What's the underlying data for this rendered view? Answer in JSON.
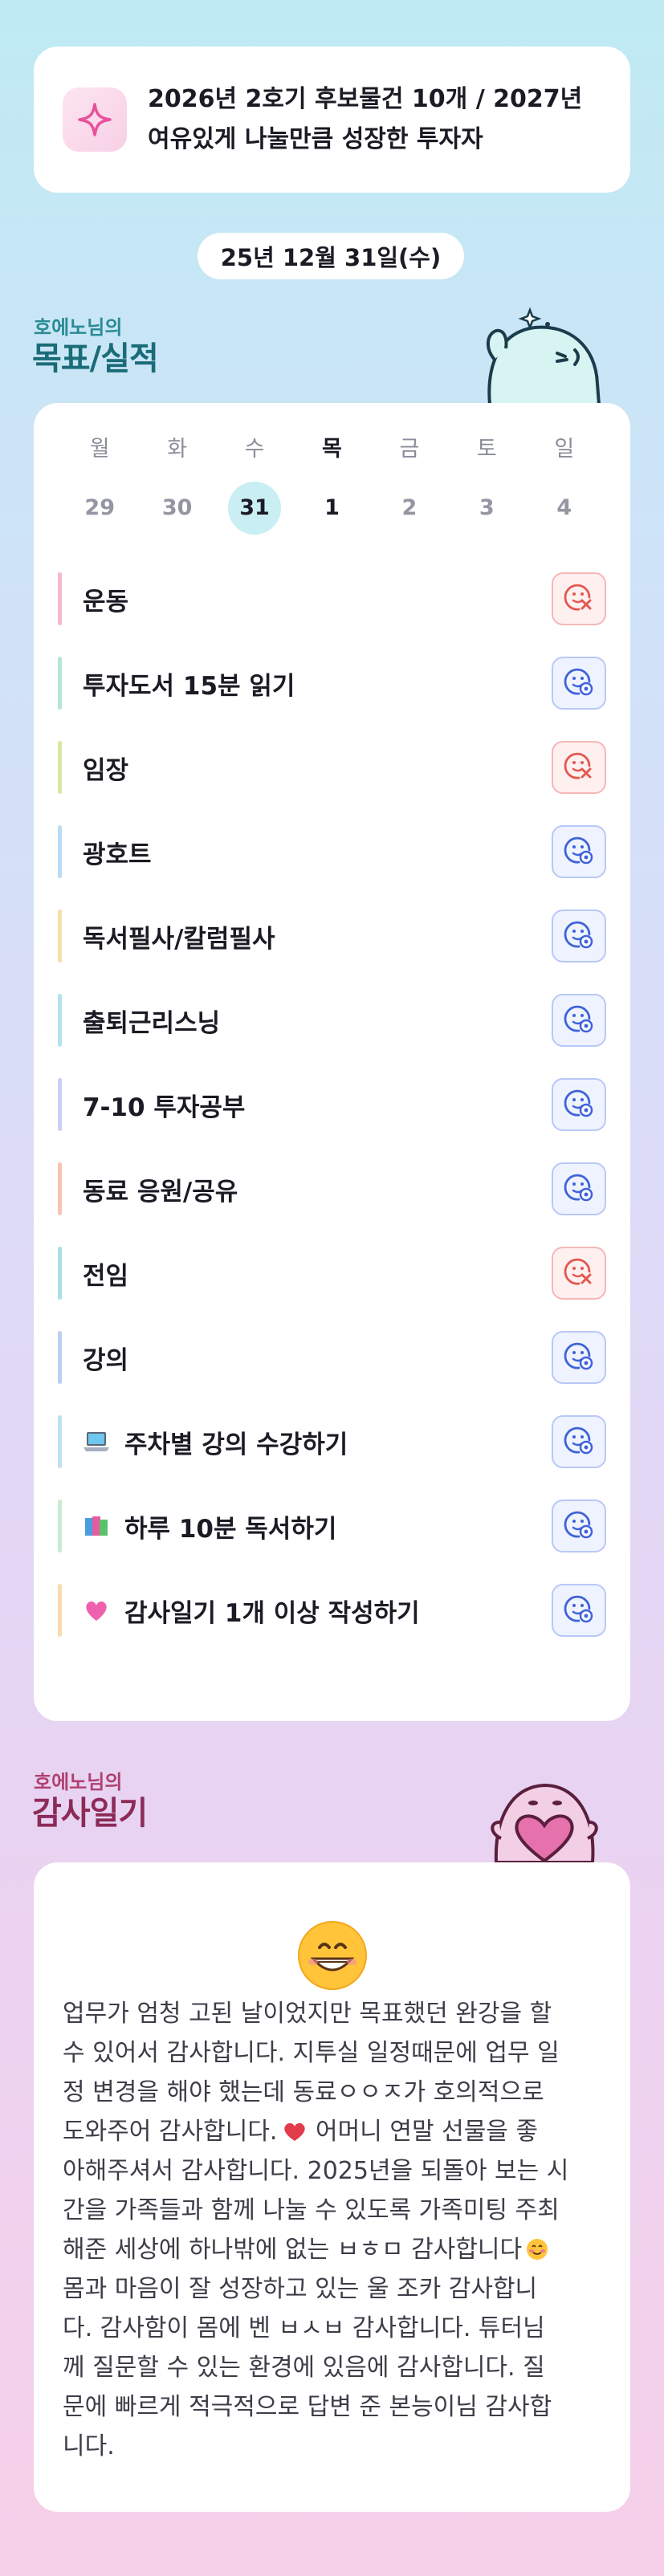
{
  "goal_banner": {
    "text": "2026년 2호기 후보물건 10개 / 2027년 여유있게 나눌만큼 성장한 투자자",
    "icon": "sparkle-icon"
  },
  "date": "25년 12월 31일(수)",
  "goals_section": {
    "subtitle": "호에노님의",
    "title": "목표/실적"
  },
  "week": [
    {
      "day": "월",
      "num": "29",
      "state": "normal"
    },
    {
      "day": "화",
      "num": "30",
      "state": "normal"
    },
    {
      "day": "수",
      "num": "31",
      "state": "today"
    },
    {
      "day": "목",
      "num": "1",
      "state": "emph"
    },
    {
      "day": "금",
      "num": "2",
      "state": "normal"
    },
    {
      "day": "토",
      "num": "3",
      "state": "normal"
    },
    {
      "day": "일",
      "num": "4",
      "state": "normal"
    }
  ],
  "goals": [
    {
      "label": "운동",
      "status": "fail",
      "bar": "#f6b9c9",
      "emoji": ""
    },
    {
      "label": "투자도서 15분 읽기",
      "status": "done",
      "bar": "#b6e6d9",
      "emoji": ""
    },
    {
      "label": "임장",
      "status": "fail",
      "bar": "#d7e8a3",
      "emoji": ""
    },
    {
      "label": "광호트",
      "status": "done",
      "bar": "#b9dcf4",
      "emoji": ""
    },
    {
      "label": "독서필사/칼럼필사",
      "status": "done",
      "bar": "#f6dfa8",
      "emoji": ""
    },
    {
      "label": "출퇴근리스닝",
      "status": "done",
      "bar": "#b4e3ee",
      "emoji": ""
    },
    {
      "label": "7-10 투자공부",
      "status": "done",
      "bar": "#c7d2f2",
      "emoji": ""
    },
    {
      "label": "동료 응원/공유",
      "status": "done",
      "bar": "#f6c3b4",
      "emoji": ""
    },
    {
      "label": "전임",
      "status": "fail",
      "bar": "#a9dfe8",
      "emoji": ""
    },
    {
      "label": "강의",
      "status": "done",
      "bar": "#bcd0f1",
      "emoji": ""
    },
    {
      "label": "주차별 강의 수강하기",
      "status": "done",
      "bar": "#bfe0f3",
      "emoji": "laptop-icon"
    },
    {
      "label": "하루 10분 독서하기",
      "status": "done",
      "bar": "#c9ecd0",
      "emoji": "books-icon"
    },
    {
      "label": "감사일기 1개 이상 작성하기",
      "status": "done",
      "bar": "#f8dcae",
      "emoji": "pink-heart-icon"
    }
  ],
  "diary_section": {
    "subtitle": "호에노님의",
    "title": "감사일기"
  },
  "diary": {
    "emoji": "grinning-face-icon",
    "lines": [
      "업무가 엄청 고된 날이었지만 목표했던 완강을 할",
      "수 있어서 감사합니다. 지투실 일정때문에 업무 일",
      "정 변경을 해야 했는데 동료ㅇㅇㅈ가 호의적으로",
      "도와주어 감사합니다.",
      " 어머니 연말 선물을 좋",
      "아해주셔서 감사합니다. 2025년을 되돌아 보는 시",
      "간을 가족들과 함께 나눌 수 있도록 가족미팅 주최",
      "해준 세상에 하나밖에 없는 ㅂㅎㅁ 감사합니다",
      "몸과 마음이 잘 성장하고 있는 울 조카 감사합니",
      "다. 감사함이 몸에 벤 ㅂㅅㅂ 감사합니다. 튜터님",
      "께 질문할 수 있는 환경에 있음에 감사합니다. 질",
      "문에 빠르게 적극적으로 답변 준 본능이님 감사합",
      "니다."
    ]
  },
  "colors": {
    "done": "#3f63d8",
    "fail": "#e4574f",
    "today": "#c9eef4"
  }
}
